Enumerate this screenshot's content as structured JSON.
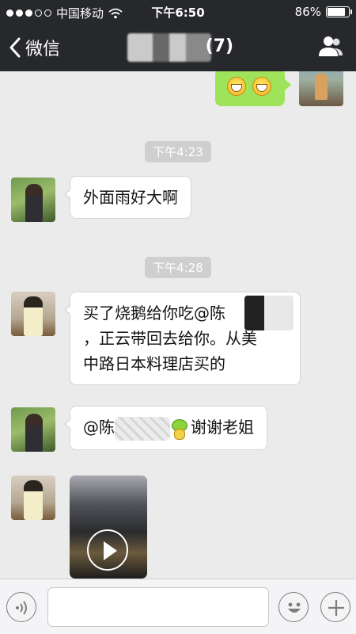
{
  "status_bar": {
    "carrier": "中国移动",
    "time": "下午6:50",
    "battery": "86%",
    "battery_level": 0.86
  },
  "nav": {
    "back_label": "微信",
    "title_suffix": "(7)"
  },
  "messages": {
    "out_emoji_count": 2,
    "ts1": "下午4:23",
    "msg1": "外面雨好大啊",
    "ts2": "下午4:28",
    "msg2_line1": "买了烧鹅给你吃@陈",
    "msg2_line2": "，正云带回去给你。从美",
    "msg2_line3": "中路日本料理店买的",
    "msg3_prefix": "@陈",
    "msg3_suffix": "谢谢老姐"
  },
  "input": {
    "value": "",
    "placeholder": ""
  },
  "colors": {
    "nav_bg": "#27282c",
    "chat_bg": "#ebebeb",
    "out_bubble": "#9fe35a",
    "in_bubble": "#ffffff",
    "timestamp_bg": "#cfcfcf"
  },
  "icons": {
    "back": "chevron-left-icon",
    "profile": "group-profile-icon",
    "voice": "voice-icon",
    "emoji": "emoji-icon",
    "plus": "plus-icon",
    "play": "play-icon"
  }
}
